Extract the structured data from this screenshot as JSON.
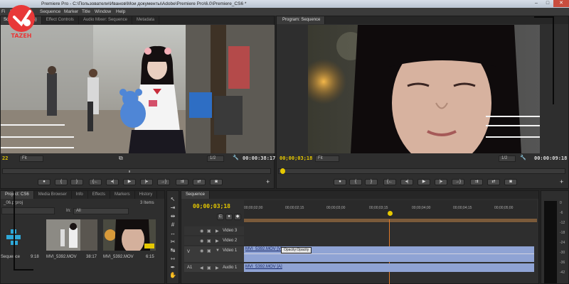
{
  "window": {
    "title": "Premiere Pro - C:\\Пользователи\\Иванов\\Мои документы\\Adobe\\Premiere Pro\\6.0\\Premiere_CS6 *",
    "min": "–",
    "max": "□",
    "close": "✕"
  },
  "menu": [
    "Fi",
    "Pr",
    "Sequence",
    "Marker",
    "Title",
    "Window",
    "Help"
  ],
  "source_monitor": {
    "tabs": [
      "Source: (no clips)",
      "Effect Controls",
      "Audio Mixer: Sequence",
      "Metadata"
    ],
    "timecode_in": "22",
    "zoom": "Fit",
    "resolution": "1/2",
    "duration": "00:00:38:17"
  },
  "program_monitor": {
    "tab": "Program: Sequence",
    "timecode": "00;00;03;18",
    "zoom": "Fit",
    "resolution": "1/2",
    "duration": "00:00:09:18"
  },
  "transport_icons": [
    "marker-icon",
    "mark-in-icon",
    "mark-out-icon",
    "go-to-in-icon",
    "step-back-icon",
    "play-icon",
    "step-forward-icon",
    "go-to-out-icon",
    "insert-icon",
    "overwrite-icon",
    "export-frame-icon"
  ],
  "transport_glyphs": [
    "●",
    "{",
    "}",
    "{←",
    "◂|",
    "▶",
    "|▸",
    "→}",
    "⇉",
    "⇄",
    "◙"
  ],
  "project": {
    "tabs": [
      "Project: CS6",
      "Media Browser",
      "Info",
      "Effects",
      "Markers",
      "History"
    ],
    "filename": "_06.prproj",
    "items_count": "3 Items",
    "in_label": "In:",
    "in_value": "All",
    "items": [
      {
        "name": "Sequence",
        "duration": "9:18"
      },
      {
        "name": "MVI_5392.MOV",
        "duration": "38:17"
      },
      {
        "name": "MVI_5392.MOV",
        "duration": "6:15"
      }
    ]
  },
  "timeline": {
    "tab": "Sequence",
    "timecode": "00;00;03;18",
    "ruler": [
      "00;00;02;00",
      "00;00;02;15",
      "00;00;03;00",
      "00;00;03;15",
      "00;00;04;00",
      "00;00;04;15",
      "00;00;05;00"
    ],
    "tracks": [
      {
        "name": "Video 3",
        "type": "video"
      },
      {
        "name": "Video 2",
        "type": "video"
      },
      {
        "name": "Video 1",
        "type": "video",
        "clip": "MVI_5392.MOV [V]",
        "effect": "Opacity:Opacity"
      },
      {
        "name": "Audio 1",
        "type": "audio",
        "clip": "MVI_5392.MOV [A]"
      }
    ],
    "v_label": "V",
    "a_label": "A1"
  },
  "meter_labels": [
    "0",
    "-6",
    "-12",
    "-18",
    "-24",
    "-30",
    "-36",
    "-42"
  ],
  "tools": [
    "selection-tool-icon",
    "track-select-icon",
    "ripple-edit-icon",
    "rolling-edit-icon",
    "rate-stretch-icon",
    "razor-icon",
    "slip-icon",
    "slide-icon",
    "pen-icon",
    "hand-icon",
    "zoom-icon"
  ],
  "tool_glyphs": [
    "↖",
    "⇥",
    "⇹",
    "#",
    "↔",
    "✂",
    "↹",
    "⇿",
    "✒",
    "✋",
    "🔍"
  ],
  "colors": {
    "accent_timecode": "#e6c800",
    "playhead": "#e07a2a",
    "video_clip": "#8fa3d4",
    "audio_clip": "#8fa3d4",
    "panel_bg": "#2e2e2e"
  }
}
